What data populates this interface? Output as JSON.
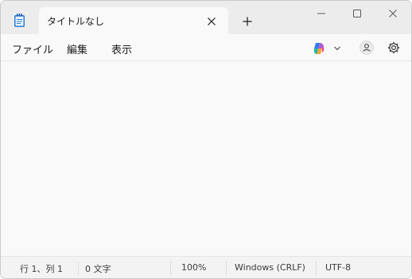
{
  "window": {
    "tab_title": "タイトルなし",
    "colors": {
      "titlebar": "#ececec",
      "content": "#f9f9f9",
      "statusbar": "#f3f3f3"
    }
  },
  "icons": {
    "app": "notepad-icon",
    "tab_close": "close-icon",
    "new_tab": "plus-icon",
    "minimize": "minimize-icon",
    "maximize": "maximize-icon",
    "close": "close-icon",
    "copilot": "copilot-icon",
    "dropdown": "chevron-down-icon",
    "account": "account-icon",
    "settings": "gear-icon"
  },
  "menu": {
    "file": "ファイル",
    "edit": "編集",
    "view": "表示"
  },
  "editor": {
    "text": ""
  },
  "status": {
    "position": "行 1、列 1",
    "char_count": "0 文字",
    "zoom": "100%",
    "line_ending": "Windows (CRLF)",
    "encoding": "UTF-8"
  }
}
